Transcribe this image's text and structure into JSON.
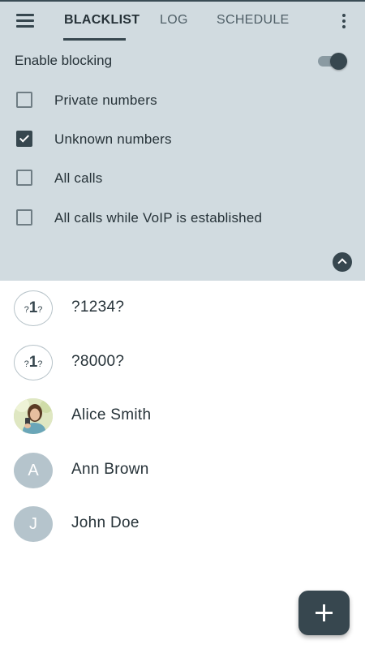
{
  "appbar": {
    "menu_icon": "hamburger-menu-icon",
    "tabs": [
      {
        "label": "BLACKLIST",
        "active": true
      },
      {
        "label": "LOG",
        "active": false
      },
      {
        "label": "SCHEDULE",
        "active": false
      }
    ],
    "overflow_icon": "more-vert-icon"
  },
  "settings": {
    "enable_label": "Enable blocking",
    "enable_on": true,
    "options": [
      {
        "label": "Private numbers",
        "checked": false
      },
      {
        "label": "Unknown numbers",
        "checked": true
      },
      {
        "label": "All calls",
        "checked": false
      },
      {
        "label": "All calls while VoIP is established",
        "checked": false
      }
    ],
    "collapse_icon": "chevron-up-icon"
  },
  "blacklist": [
    {
      "name": "?1234?",
      "avatar_type": "unknown"
    },
    {
      "name": "?8000?",
      "avatar_type": "unknown"
    },
    {
      "name": "Alice Smith",
      "avatar_type": "photo"
    },
    {
      "name": "Ann Brown",
      "avatar_type": "letter",
      "initial": "A"
    },
    {
      "name": "John Doe",
      "avatar_type": "letter",
      "initial": "J"
    }
  ],
  "unknown_avatar": {
    "left": "?",
    "center": "1",
    "right": "?"
  },
  "fab": {
    "icon": "add-icon"
  },
  "colors": {
    "panel_bg": "#d1dbe0",
    "accent": "#37474f",
    "avatar_letter_bg": "#b5c4cc"
  }
}
